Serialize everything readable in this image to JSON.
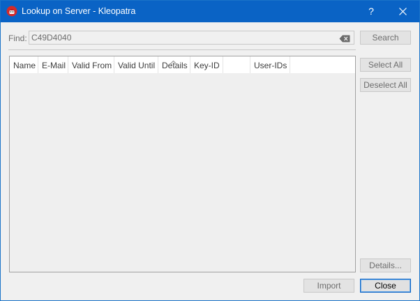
{
  "window": {
    "title": "Lookup on Server - Kleopatra",
    "help_label": "?"
  },
  "find": {
    "label": "Find:",
    "value": "C49D4040"
  },
  "buttons": {
    "search": "Search",
    "select_all": "Select All",
    "deselect_all": "Deselect All",
    "details": "Details...",
    "import": "Import",
    "close": "Close"
  },
  "table": {
    "columns": [
      "Name",
      "E-Mail",
      "Valid From",
      "Valid Until",
      "Details",
      "Key-ID",
      "",
      "User-IDs"
    ],
    "sorted_column": "Details",
    "rows": []
  },
  "icons": {
    "app": "kleopatra-app-icon",
    "clear": "clear-text-icon",
    "close": "close-icon"
  },
  "colors": {
    "titlebar": "#0a63c5",
    "accent_border": "#0a63c5",
    "app_icon_red": "#d42a2a"
  }
}
